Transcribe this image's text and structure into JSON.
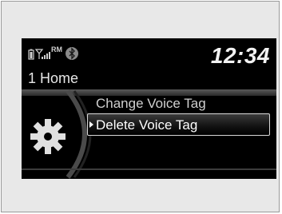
{
  "status": {
    "icons": [
      "phone-battery-icon",
      "signal-strength-icon",
      "roaming-icon",
      "bluetooth-icon"
    ],
    "roaming_label": "RM"
  },
  "clock": "12:34",
  "breadcrumb": "1 Home",
  "menu": {
    "items": [
      {
        "label": "Change Voice Tag",
        "selected": false
      },
      {
        "label": "Delete Voice Tag",
        "selected": true
      }
    ]
  },
  "colors": {
    "screen_bg": "#000000",
    "text": "#d0d0d0",
    "highlight_border": "#d8d8d8"
  }
}
